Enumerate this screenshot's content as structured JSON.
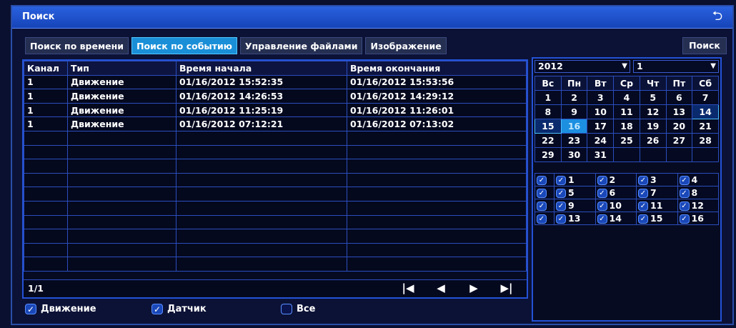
{
  "window": {
    "title": "Поиск",
    "back_icon": "return-arrow-icon"
  },
  "tabs": [
    {
      "label": "Поиск по времени",
      "active": false
    },
    {
      "label": "Поиск по событию",
      "active": true
    },
    {
      "label": "Управление файлами",
      "active": false
    },
    {
      "label": "Изображение",
      "active": false
    }
  ],
  "search_button": "Поиск",
  "table": {
    "headers": [
      "Канал",
      "Тип",
      "Время начала",
      "Время окончания"
    ],
    "rows": [
      [
        "1",
        "Движение",
        "01/16/2012 15:52:35",
        "01/16/2012 15:53:56"
      ],
      [
        "1",
        "Движение",
        "01/16/2012 14:26:53",
        "01/16/2012 14:29:12"
      ],
      [
        "1",
        "Движение",
        "01/16/2012 11:25:19",
        "01/16/2012 11:26:01"
      ],
      [
        "1",
        "Движение",
        "01/16/2012 07:12:21",
        "01/16/2012 07:13:02"
      ]
    ],
    "page": "1/1"
  },
  "filters": [
    {
      "label": "Движение",
      "checked": true
    },
    {
      "label": "Датчик",
      "checked": true
    },
    {
      "label": "Все",
      "checked": false
    }
  ],
  "calendar": {
    "year": "2012",
    "month": "1",
    "weekdays": [
      "Вс",
      "Пн",
      "Вт",
      "Ср",
      "Чт",
      "Пт",
      "Сб"
    ],
    "weeks": [
      [
        "1",
        "2",
        "3",
        "4",
        "5",
        "6",
        "7"
      ],
      [
        "8",
        "9",
        "10",
        "11",
        "12",
        "13",
        "14"
      ],
      [
        "15",
        "16",
        "17",
        "18",
        "19",
        "20",
        "21"
      ],
      [
        "22",
        "23",
        "24",
        "25",
        "26",
        "27",
        "28"
      ],
      [
        "29",
        "30",
        "31",
        "",
        "",
        "",
        ""
      ]
    ],
    "selected_day": "16",
    "recorded_days": [
      "14",
      "15"
    ]
  },
  "channels": [
    {
      "label": "",
      "checked": true
    },
    {
      "label": "1",
      "checked": true
    },
    {
      "label": "2",
      "checked": true
    },
    {
      "label": "3",
      "checked": true
    },
    {
      "label": "4",
      "checked": true
    },
    {
      "label": "",
      "checked": true
    },
    {
      "label": "5",
      "checked": true
    },
    {
      "label": "6",
      "checked": true
    },
    {
      "label": "7",
      "checked": true
    },
    {
      "label": "8",
      "checked": true
    },
    {
      "label": "",
      "checked": true
    },
    {
      "label": "9",
      "checked": true
    },
    {
      "label": "10",
      "checked": true
    },
    {
      "label": "11",
      "checked": true
    },
    {
      "label": "12",
      "checked": true
    },
    {
      "label": "",
      "checked": true
    },
    {
      "label": "13",
      "checked": true
    },
    {
      "label": "14",
      "checked": true
    },
    {
      "label": "15",
      "checked": true
    },
    {
      "label": "16",
      "checked": true
    }
  ]
}
